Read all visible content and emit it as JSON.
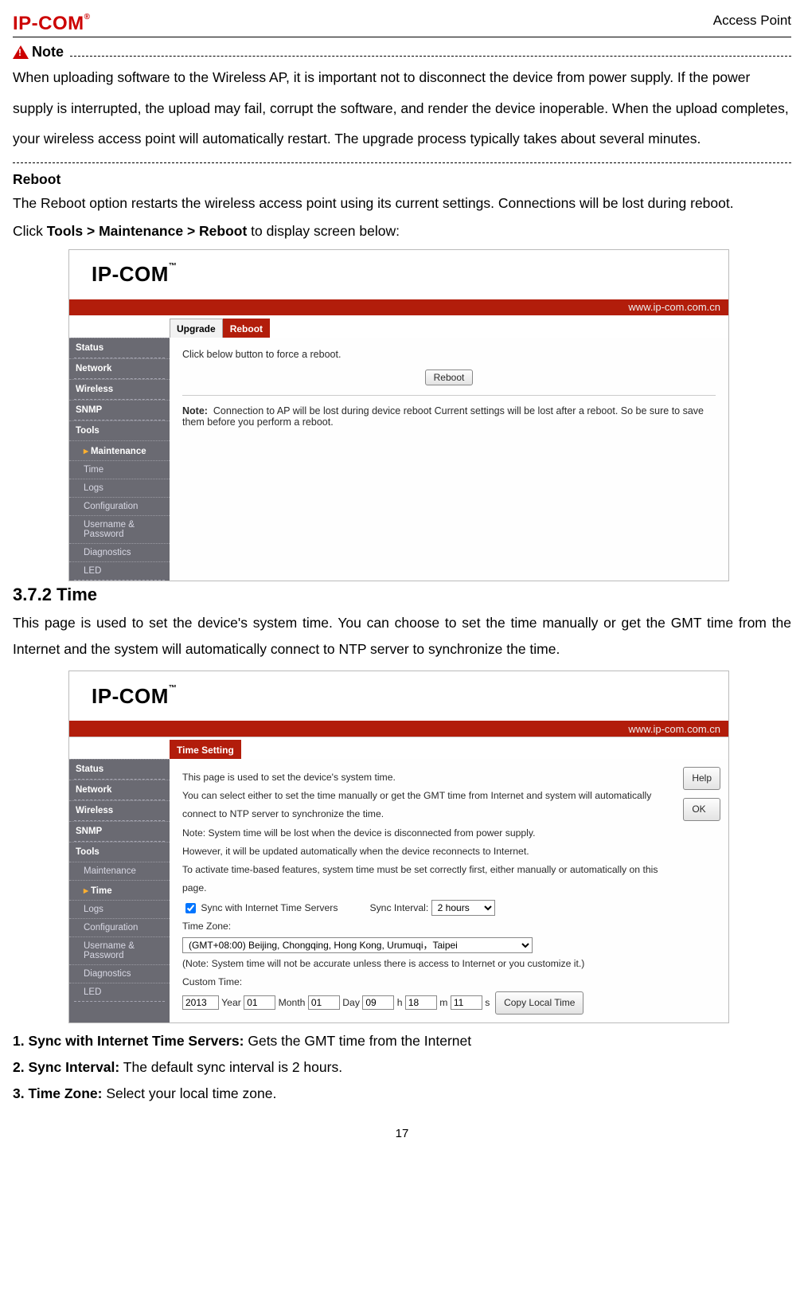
{
  "header": {
    "brand": "IP‑COM",
    "reg": "®",
    "apoint": "Access Point"
  },
  "note": {
    "label": "Note",
    "text": "When uploading software to the Wireless AP, it is important not to disconnect the device from power supply. If the power supply is interrupted, the upload may fail, corrupt the software, and render the device inoperable. When the upload completes, your wireless access point will automatically restart. The upgrade process typically takes about several minutes."
  },
  "reboot": {
    "title": "Reboot",
    "desc": "The Reboot option restarts the wireless access point using its current settings. Connections will be lost during reboot.",
    "click_pre": "Click ",
    "click_bold": "Tools > Maintenance > Reboot",
    "click_post": " to display screen below:"
  },
  "shot1": {
    "logo": "IP‑COM",
    "url": "www.ip-com.com.cn",
    "tabs": {
      "upgrade": "Upgrade",
      "reboot": "Reboot"
    },
    "side": {
      "status": "Status",
      "network": "Network",
      "wireless": "Wireless",
      "snmp": "SNMP",
      "tools": "Tools",
      "maintenance": "Maintenance",
      "time": "Time",
      "logs": "Logs",
      "config": "Configuration",
      "userpass": "Username & Password",
      "diag": "Diagnostics",
      "led": "LED"
    },
    "main": {
      "line1": "Click below button to force a reboot.",
      "btn": "Reboot",
      "note_label": "Note:",
      "note_text": "Connection to AP will be lost during device reboot Current settings will be lost after a reboot. So be sure to save them before you perform a reboot."
    }
  },
  "time_section": {
    "h": "3.7.2 Time",
    "p": "This page is used to set the device's system time. You can choose to set the time manually or get the GMT time from the Internet and the system will automatically connect to NTP server to synchronize the time."
  },
  "shot2": {
    "logo": "IP‑COM",
    "url": "www.ip-com.com.cn",
    "tab": "Time Setting",
    "side": {
      "status": "Status",
      "network": "Network",
      "wireless": "Wireless",
      "snmp": "SNMP",
      "tools": "Tools",
      "maintenance": "Maintenance",
      "time": "Time",
      "logs": "Logs",
      "config": "Configuration",
      "userpass": "Username & Password",
      "diag": "Diagnostics",
      "led": "LED"
    },
    "main": {
      "help_btn": "Help",
      "ok_btn": "OK",
      "p1": "This page is used to set the device's system time.",
      "p2": "You can select either to set the time manually or get the GMT time from Internet and system will automatically connect to NTP server to synchronize the time.",
      "p3": "Note: System time will be lost when the device is disconnected from power supply.",
      "p4": "However, it will be updated automatically when the device reconnects to Internet.",
      "p5": "To activate time-based features, system time must be set correctly first, either manually or automatically on this page.",
      "sync_chk_label": "Sync with Internet Time Servers",
      "sync_int_label": "Sync Interval:",
      "sync_int_val": "2 hours",
      "tz_label": "Time Zone:",
      "tz_val": "(GMT+08:00) Beijing, Chongqing, Hong Kong, Urumuqi，Taipei",
      "tz_note": "(Note: System time will not be accurate unless there is access to Internet or you customize it.)",
      "custom_label": "Custom Time:",
      "year": "2013",
      "year_l": "Year",
      "month": "01",
      "month_l": "Month",
      "day": "01",
      "day_l": "Day",
      "hour": "09",
      "hour_l": "h",
      "min": "18",
      "min_l": "m",
      "sec": "11",
      "sec_l": "s",
      "copy_btn": "Copy Local Time"
    }
  },
  "defs": {
    "l1b": "1. Sync with Internet Time Servers:",
    "l1t": " Gets the GMT time from the Internet",
    "l2b": "2. Sync Interval:",
    "l2t": " The default sync interval is 2 hours.",
    "l3b": "3. Time Zone:",
    "l3t": " Select your local time zone."
  },
  "footer": {
    "page": "17"
  }
}
